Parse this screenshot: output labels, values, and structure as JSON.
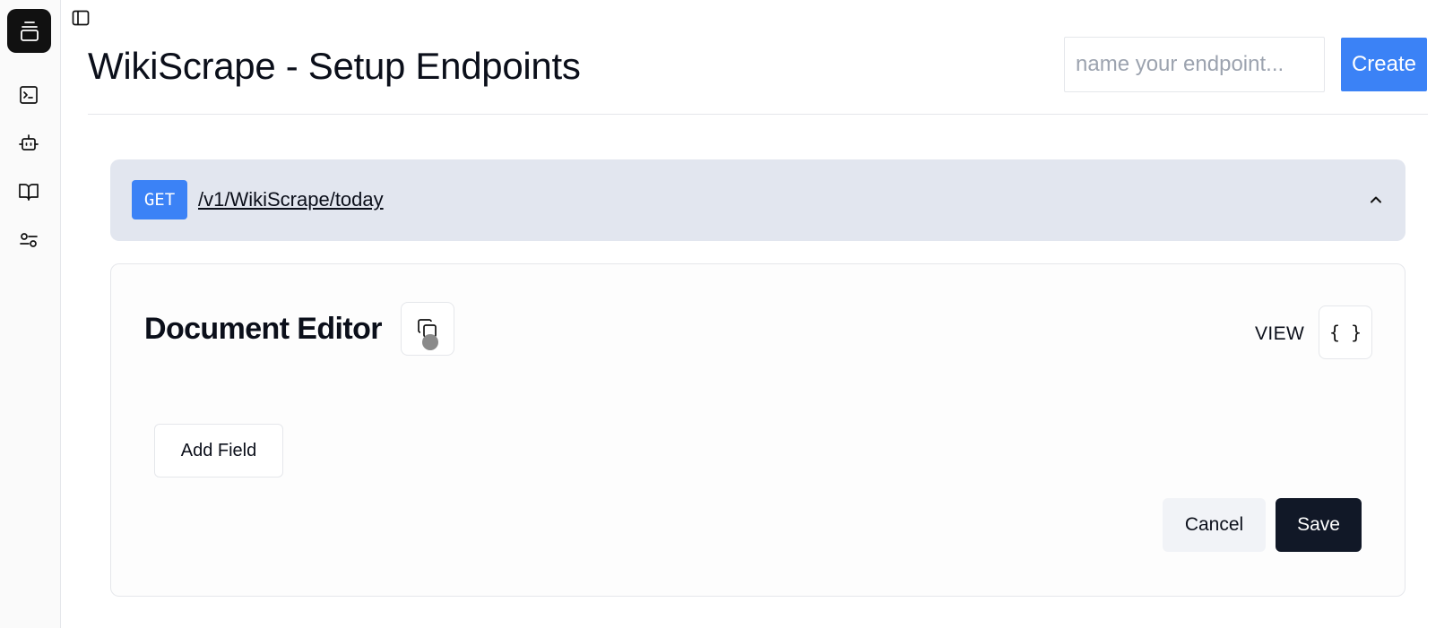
{
  "sidebar": {
    "logo_icon": "layers-icon",
    "items": [
      {
        "icon": "terminal-icon"
      },
      {
        "icon": "robot-icon"
      },
      {
        "icon": "book-open-icon"
      },
      {
        "icon": "sliders-icon"
      }
    ]
  },
  "header": {
    "toggle_icon": "sidebar-panel-icon",
    "title": "WikiScrape - Setup Endpoints",
    "input_placeholder": "name your endpoint...",
    "input_value": "",
    "create_label": "Create"
  },
  "endpoint": {
    "method": "GET",
    "path": "/v1/WikiScrape/today",
    "collapse_icon": "chevron-up-icon"
  },
  "editor": {
    "title": "Document Editor",
    "copy_icon": "copy-icon",
    "view_label": "VIEW",
    "json_toggle_label": "{ }",
    "add_field_label": "Add Field",
    "cancel_label": "Cancel",
    "save_label": "Save"
  },
  "colors": {
    "accent": "#3b82f6",
    "endpoint_bar": "#e2e6ef",
    "primary_dark": "#111827"
  }
}
